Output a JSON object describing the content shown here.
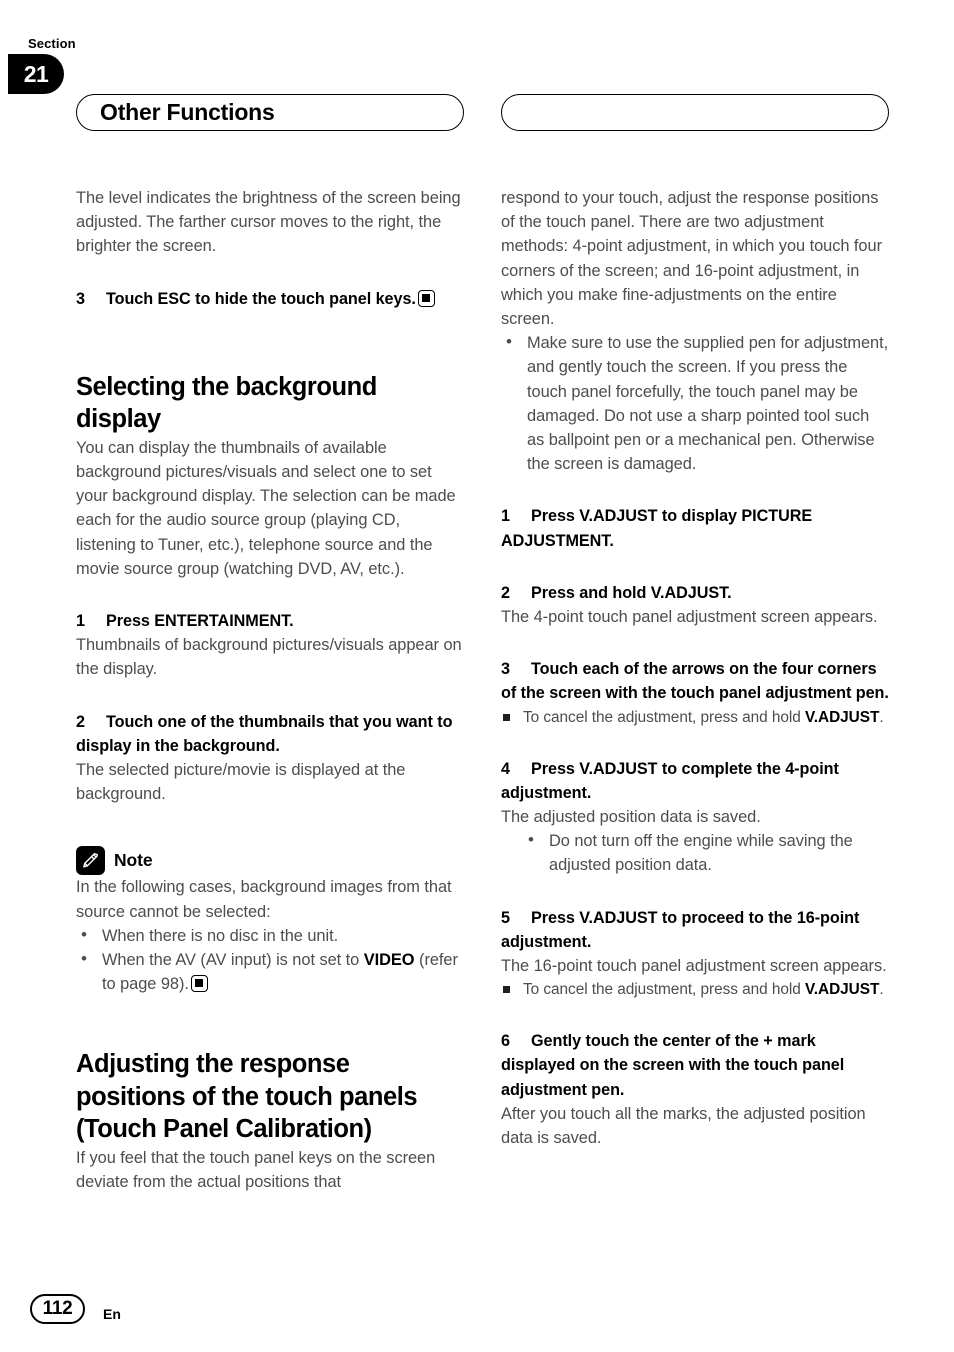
{
  "header": {
    "section_word": "Section",
    "section_number": "21",
    "title": "Other Functions",
    "right_pill_text": ""
  },
  "left_column": {
    "intro_paragraph": "The level indicates the brightness of the screen being adjusted. The farther cursor moves to the right, the brighter the screen.",
    "step3": {
      "number": "3",
      "text": "Touch ESC to hide the touch panel keys."
    },
    "heading_background": "Selecting the background display",
    "background_paragraph": "You can display the thumbnails of available background pictures/visuals and select one to set your background display. The selection can be made each for the audio source group (playing CD, listening to Tuner, etc.), telephone source and the movie source group (watching DVD, AV, etc.).",
    "step1": {
      "number": "1",
      "text": "Press ENTERTAINMENT.",
      "body": "Thumbnails of background pictures/visuals appear on the display."
    },
    "step2": {
      "number": "2",
      "text": "Touch one of the thumbnails that you want to display in the background.",
      "body": "The selected picture/movie is displayed at the background."
    },
    "note": {
      "title": "Note",
      "icon": "pencil-icon",
      "intro": "In the following cases, background images from that source cannot be selected:",
      "bullets": [
        "When there is no disc in the unit.",
        "When the AV (AV input) is not set to "
      ],
      "bullet2_bold": "VIDEO",
      "bullet2_tail": "(refer to page 98)."
    },
    "heading_calibration": "Adjusting the response positions of the touch panels (Touch Panel Calibration)",
    "calibration_paragraph_start": "If you feel that the touch panel keys on the screen deviate from the actual positions that"
  },
  "right_column": {
    "continued_paragraph": "respond to your touch, adjust the response positions of the touch panel. There are two adjustment methods: 4-point adjustment, in which you touch four corners of the screen; and 16-point adjustment, in which you make fine-adjustments on the entire screen.",
    "warning_bullet": "Make sure to use the supplied pen for adjustment, and gently touch the screen. If you press the touch panel forcefully, the touch panel may be damaged. Do not use a sharp pointed tool such as ballpoint pen or a mechanical pen. Otherwise the screen is damaged.",
    "step1": {
      "number": "1",
      "text": "Press V.ADJUST to display PICTURE ADJUSTMENT."
    },
    "step2": {
      "number": "2",
      "text": "Press and hold V.ADJUST.",
      "body": "The 4-point touch panel adjustment screen appears."
    },
    "step3": {
      "number": "3",
      "text": "Touch each of the arrows on the four corners of the screen with the touch panel adjustment pen.",
      "subnote_prefix": "To cancel the adjustment, press and hold ",
      "subnote_bold": "V.ADJUST",
      "subnote_tail": "."
    },
    "step4": {
      "number": "4",
      "text": "Press V.ADJUST to complete the 4-point adjustment.",
      "body": "The adjusted position data is saved.",
      "bullet": "Do not turn off the engine while saving the adjusted position data."
    },
    "step5": {
      "number": "5",
      "text": "Press V.ADJUST to proceed to the 16-point adjustment.",
      "body": "The 16-point touch panel adjustment screen appears.",
      "subnote_prefix": "To cancel the adjustment, press and hold ",
      "subnote_bold": "V.ADJUST",
      "subnote_tail": "."
    },
    "step6": {
      "number": "6",
      "text": "Gently touch the center of the + mark displayed on the screen with the touch panel adjustment pen.",
      "body": "After you touch all the marks, the adjusted position data is saved."
    }
  },
  "footer": {
    "page_number": "112",
    "language": "En"
  }
}
